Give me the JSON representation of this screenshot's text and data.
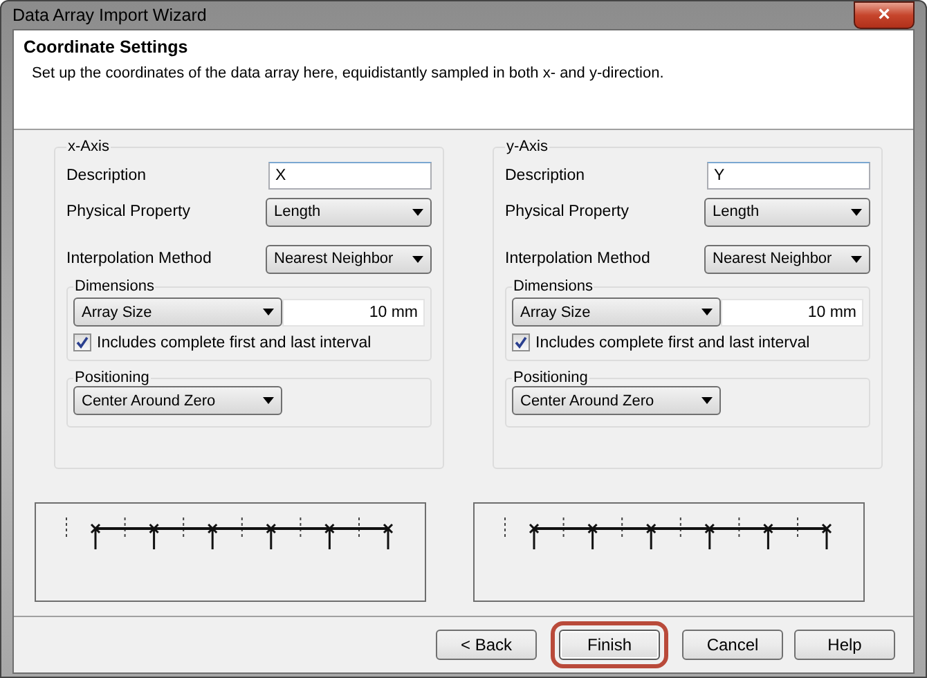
{
  "window": {
    "title": "Data Array Import Wizard",
    "close": "×"
  },
  "header": {
    "title": "Coordinate Settings",
    "subtitle": "Set up the coordinates of the data array here, equidistantly sampled in both x- and y-direction."
  },
  "axes": [
    {
      "title": "x-Axis",
      "description_label": "Description",
      "description": "X",
      "property_label": "Physical Property",
      "property": "Length",
      "interpolation_label": "Interpolation Method",
      "interpolation": "Nearest Neighbor",
      "dimensions_title": "Dimensions",
      "size_mode": "Array Size",
      "size_value": "10 mm",
      "include_interval": {
        "label": "Includes complete first and last interval",
        "checked": true
      },
      "positioning_title": "Positioning",
      "positioning": "Center Around Zero"
    },
    {
      "title": "y-Axis",
      "description_label": "Description",
      "description": "Y",
      "property_label": "Physical Property",
      "property": "Length",
      "interpolation_label": "Interpolation Method",
      "interpolation": "Nearest Neighbor",
      "dimensions_title": "Dimensions",
      "size_mode": "Array Size",
      "size_value": "10 mm",
      "include_interval": {
        "label": "Includes complete first and last interval",
        "checked": true
      },
      "positioning_title": "Positioning",
      "positioning": "Center Around Zero"
    }
  ],
  "buttons": [
    {
      "label": "< Back",
      "highlighted": false
    },
    {
      "label": "Finish",
      "highlighted": true
    },
    {
      "label": "Cancel",
      "highlighted": false
    },
    {
      "label": "Help",
      "highlighted": false
    }
  ]
}
